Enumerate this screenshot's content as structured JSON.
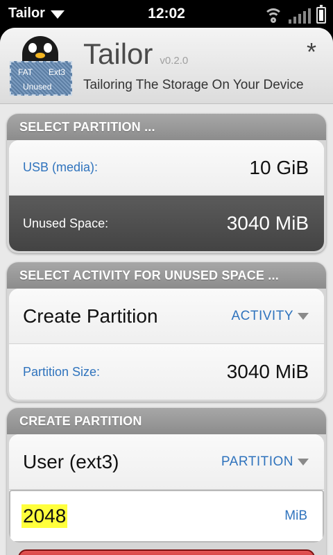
{
  "status_bar": {
    "app_name": "Tailor",
    "time": "12:02"
  },
  "header": {
    "title": "Tailor",
    "version": "v0.2.0",
    "subtitle": "Tailoring The Storage On Your Device",
    "logo_labels": {
      "fat": "FAT",
      "ext3": "Ext3",
      "unused": "Unused"
    },
    "modified_marker": "*"
  },
  "select_partition": {
    "title": "SELECT PARTITION ...",
    "rows": [
      {
        "label": "USB (media):",
        "value": "10 GiB",
        "selected": false
      },
      {
        "label": "Unused Space:",
        "value": "3040 MiB",
        "selected": true
      }
    ]
  },
  "select_activity": {
    "title": "SELECT ACTIVITY FOR UNUSED SPACE ...",
    "activity_value": "Create Partition",
    "activity_picker_label": "ACTIVITY",
    "size_label": "Partition Size:",
    "size_value": "3040 MiB"
  },
  "create_partition": {
    "title": "CREATE PARTITION",
    "type_value": "User (ext3)",
    "type_picker_label": "PARTITION",
    "size_input_value": "2048",
    "size_unit": "MiB"
  },
  "colors": {
    "accent_blue": "#2f73bd",
    "selected_row": "#4a4a4a",
    "highlight": "#ffff3c",
    "action_red": "#c42a2a"
  }
}
